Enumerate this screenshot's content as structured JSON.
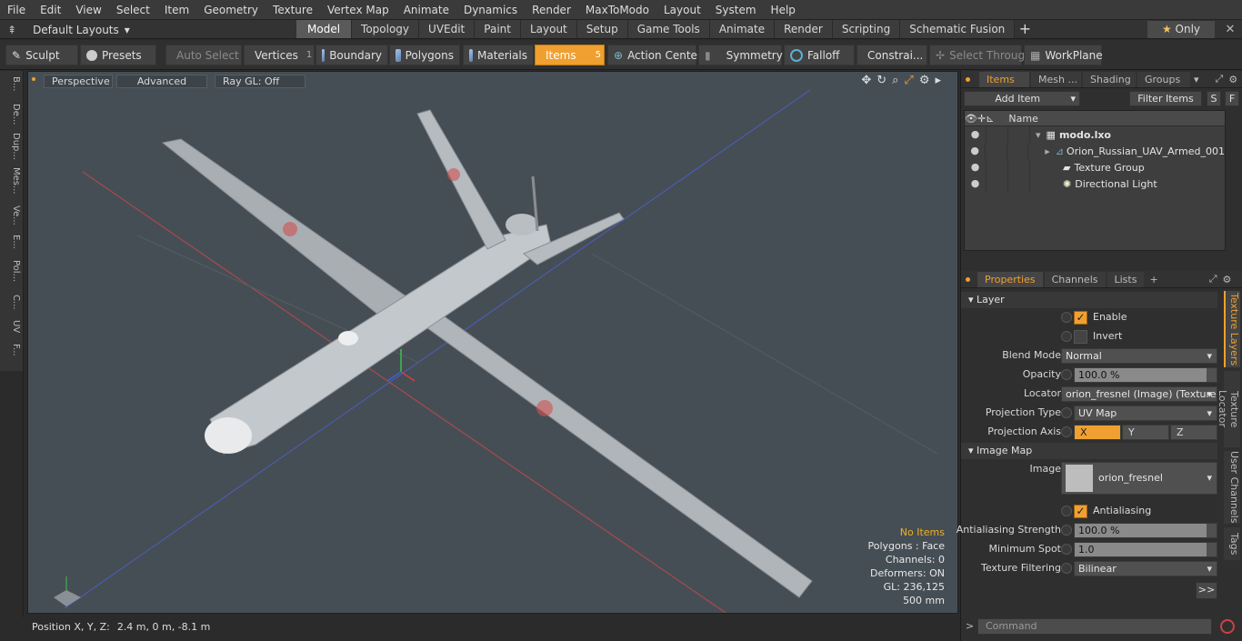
{
  "menu": [
    "File",
    "Edit",
    "View",
    "Select",
    "Item",
    "Geometry",
    "Texture",
    "Vertex Map",
    "Animate",
    "Dynamics",
    "Render",
    "MaxToModo",
    "Layout",
    "System",
    "Help"
  ],
  "layout_selector": "Default Layouts",
  "tabs": [
    "Model",
    "Topology",
    "UVEdit",
    "Paint",
    "Layout",
    "Setup",
    "Game Tools",
    "Animate",
    "Render",
    "Scripting",
    "Schematic Fusion"
  ],
  "active_tab": "Model",
  "only_label": "Only",
  "toolbar": {
    "sculpt": "Sculpt",
    "presets": "Presets",
    "auto_select": "Auto Select",
    "vertices": "Vertices",
    "vertices_count": "1",
    "boundary": "Boundary",
    "polygons": "Polygons",
    "materials": "Materials",
    "items": "Items",
    "items_count": "5",
    "action_center": "Action Center",
    "symmetry": "Symmetry",
    "falloff": "Falloff",
    "constraints": "Constrai...",
    "select_through": "Select Through",
    "workplane": "WorkPlane"
  },
  "left_tabs": [
    "B...",
    "De...",
    "Dup...",
    "Mes...",
    "Ve...",
    "E...",
    "Pol...",
    "C...",
    "UV",
    "F..."
  ],
  "viewport": {
    "view": "Perspective",
    "advanced": "Advanced",
    "raygl": "Ray GL: Off",
    "info": {
      "items": "No Items",
      "polygons": "Polygons : Face",
      "channels": "Channels: 0",
      "deformers": "Deformers: ON",
      "gl": "GL: 236,125",
      "scale": "500 mm"
    }
  },
  "status": {
    "position_label": "Position X, Y, Z:",
    "position_value": "2.4 m, 0 m, -8.1 m"
  },
  "items_panel": {
    "tabs": [
      "Items",
      "Mesh ...",
      "Shading",
      "Groups"
    ],
    "add_item": "Add Item",
    "filter": "Filter Items",
    "s": "S",
    "f": "F",
    "name_header": "Name",
    "rows": [
      "modo.lxo",
      "Orion_Russian_UAV_Armed_001",
      "Texture Group",
      "Directional Light"
    ]
  },
  "properties": {
    "tabs": [
      "Properties",
      "Channels",
      "Lists"
    ],
    "layer_section": "Layer",
    "enable": "Enable",
    "invert": "Invert",
    "blend_mode_label": "Blend Mode",
    "blend_mode": "Normal",
    "opacity_label": "Opacity",
    "opacity": "100.0 %",
    "locator_label": "Locator",
    "locator": "orion_fresnel (Image) (Texture)",
    "projection_type_label": "Projection Type",
    "projection_type": "UV Map",
    "projection_axis_label": "Projection Axis",
    "axis_x": "X",
    "axis_y": "Y",
    "axis_z": "Z",
    "image_map_section": "Image Map",
    "image_label": "Image",
    "image": "orion_fresnel",
    "antialiasing": "Antialiasing",
    "aa_strength_label": "Antialiasing Strength",
    "aa_strength": "100.0 %",
    "min_spot_label": "Minimum Spot",
    "min_spot": "1.0",
    "filtering_label": "Texture Filtering",
    "filtering": "Bilinear",
    "more": ">>",
    "side_tabs": [
      "Texture Layers",
      "Texture Locator",
      "User Channels",
      "Tags"
    ]
  },
  "command_placeholder": "Command",
  "colors": {
    "accent": "#f0a030",
    "viewport_bg": "#464e55"
  }
}
